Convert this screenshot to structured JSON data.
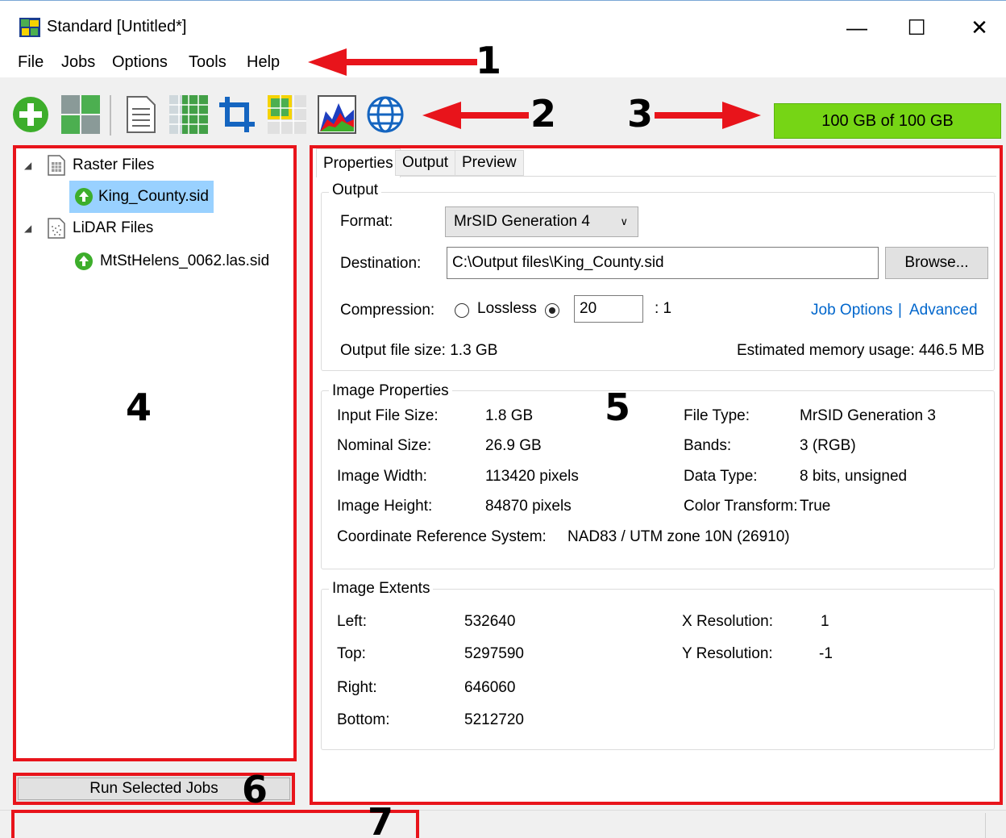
{
  "window": {
    "title": "Standard [Untitled*]",
    "minimize": "—",
    "maximize": "☐",
    "close": "✕"
  },
  "menu": [
    "File",
    "Jobs",
    "Options",
    "Tools",
    "Help"
  ],
  "toolbar": {
    "icons": [
      "add-icon",
      "mosaic-icon",
      "document-icon",
      "grid-icon",
      "crop-icon",
      "tiles-icon",
      "histogram-icon",
      "globe-icon"
    ],
    "storage": "100 GB of 100 GB"
  },
  "annotations": [
    "1",
    "2",
    "3",
    "4",
    "5",
    "6",
    "7"
  ],
  "tree": {
    "groups": [
      {
        "label": "Raster Files",
        "items": [
          "King_County.sid"
        ]
      },
      {
        "label": "LiDAR Files",
        "items": [
          "MtStHelens_0062.las.sid"
        ]
      }
    ]
  },
  "run_button": "Run Selected Jobs",
  "tabs": [
    "Properties",
    "Output",
    "Preview"
  ],
  "output": {
    "title": "Output",
    "format_label": "Format:",
    "format_value": "MrSID Generation 4",
    "destination_label": "Destination:",
    "destination_value": "C:\\Output files\\King_County.sid",
    "browse": "Browse...",
    "compression_label": "Compression:",
    "lossless": "Lossless",
    "ratio": "20",
    "ratio_suffix": ": 1",
    "job_options": "Job Options",
    "link_sep": "|",
    "advanced": "Advanced",
    "file_size": "Output file size: 1.3 GB",
    "memory": "Estimated memory usage: 446.5 MB"
  },
  "image_properties": {
    "title": "Image Properties",
    "rows": [
      {
        "label": "Input File Size:",
        "value": "1.8 GB",
        "label2": "File Type:",
        "value2": "MrSID Generation 3"
      },
      {
        "label": "Nominal Size:",
        "value": "26.9 GB",
        "label2": "Bands:",
        "value2": "3 (RGB)"
      },
      {
        "label": "Image Width:",
        "value": "113420 pixels",
        "label2": "Data Type:",
        "value2": "8 bits, unsigned"
      },
      {
        "label": "Image Height:",
        "value": "84870 pixels",
        "label2": "Color Transform:",
        "value2": "True"
      }
    ],
    "crs_label": "Coordinate Reference System:",
    "crs_value": "NAD83 / UTM zone 10N (26910)"
  },
  "image_extents": {
    "title": "Image Extents",
    "rows": [
      {
        "label": "Left:",
        "value": "532640",
        "label2": "X Resolution:",
        "value2": "1"
      },
      {
        "label": "Top:",
        "value": "5297590",
        "label2": "Y Resolution:",
        "value2": "-1"
      },
      {
        "label": "Right:",
        "value": "646060"
      },
      {
        "label": "Bottom:",
        "value": "5212720"
      }
    ]
  }
}
